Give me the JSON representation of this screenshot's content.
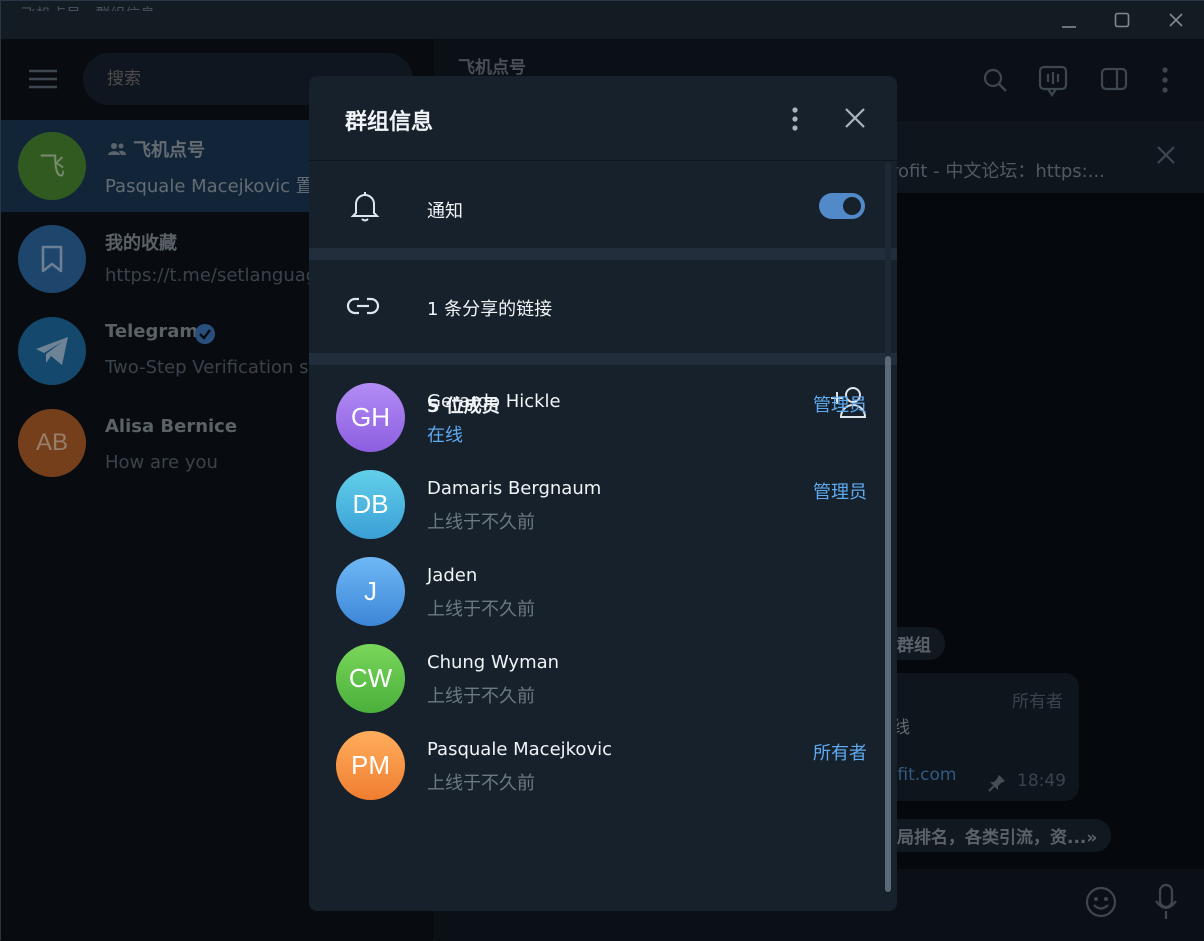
{
  "window": {
    "title_text": "飞机点号 · 群组信息"
  },
  "sidebar": {
    "search_placeholder": "搜索",
    "chats": [
      {
        "name": "飞机点号",
        "subtitle": "Pasquale Macejkovic 置",
        "avatar_text": "飞",
        "avatar_color": "#5aa03a"
      },
      {
        "name": "我的收藏",
        "subtitle": "https://t.me/setlanguag",
        "avatar_text": "",
        "avatar_color": "#3d7bc2"
      },
      {
        "name": "Telegram",
        "subtitle": "Two-Step Verification s",
        "avatar_text": "",
        "avatar_color": "#2b86c9"
      },
      {
        "name": "Alisa Bernice",
        "subtitle": "How are you",
        "avatar_text": "AB",
        "avatar_color": "#d9732d"
      }
    ]
  },
  "chat": {
    "title": "飞机点号",
    "pinned_text": "rofit - 中文论坛：https:...",
    "service_group": "群组",
    "bubble_role": "所有者",
    "bubble_text": "线",
    "bubble_link": "ofit.com",
    "bubble_time": "18:49",
    "service_bottom": "局排名，各类引流，资...»"
  },
  "dialog": {
    "title": "群组信息",
    "notifications_label": "通知",
    "notifications_on": true,
    "shared_links_label": "1 条分享的链接",
    "members_label": "5 位成员",
    "members": [
      {
        "initials": "GH",
        "name": "Gerardo Hickle",
        "status": "在线",
        "online": true,
        "role": "管理员",
        "colors": [
          "#b28cf5",
          "#8d5ee0"
        ]
      },
      {
        "initials": "DB",
        "name": "Damaris Bergnaum",
        "status": "上线于不久前",
        "online": false,
        "role": "管理员",
        "colors": [
          "#62d0ea",
          "#3a9fd6"
        ]
      },
      {
        "initials": "J",
        "name": "Jaden",
        "status": "上线于不久前",
        "online": false,
        "role": "",
        "colors": [
          "#6fb8f5",
          "#3d86d8"
        ]
      },
      {
        "initials": "CW",
        "name": "Chung Wyman",
        "status": "上线于不久前",
        "online": false,
        "role": "",
        "colors": [
          "#79d65a",
          "#4ab03b"
        ]
      },
      {
        "initials": "PM",
        "name": "Pasquale Macejkovic",
        "status": "上线于不久前",
        "online": false,
        "role": "所有者",
        "colors": [
          "#ffae5c",
          "#f07d30"
        ]
      }
    ]
  }
}
